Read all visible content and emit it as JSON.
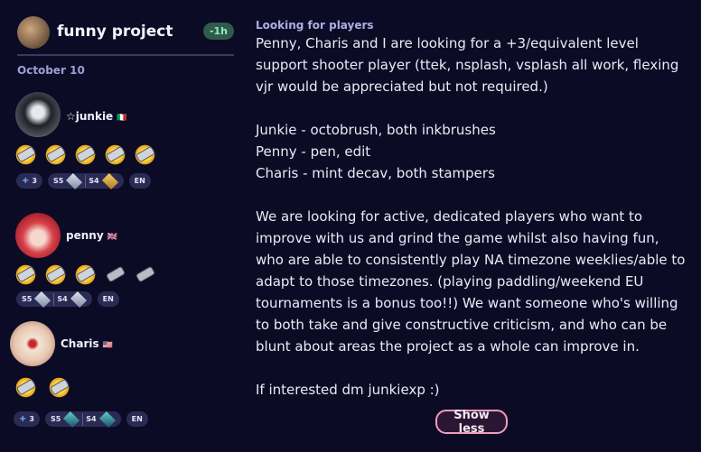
{
  "team": {
    "name": "funny project",
    "time_ago": "-1h"
  },
  "date": "October 10",
  "players": [
    {
      "name": "☆junkie",
      "flag": "🇮🇹",
      "weapons": [
        "weapon-icon",
        "weapon-icon",
        "weapon-icon",
        "weapon-icon",
        "weapon-icon"
      ],
      "plus_level": "3",
      "s5": "S5",
      "s4": "S4",
      "lang": "EN"
    },
    {
      "name": "penny",
      "flag": "🇬🇧",
      "weapons": [
        "weapon-icon",
        "weapon-icon",
        "weapon-icon",
        "weapon-icon",
        "weapon-icon"
      ],
      "s5": "S5",
      "s4": "S4",
      "lang": "EN"
    },
    {
      "name": "Charis",
      "flag": "🇺🇸",
      "weapons": [
        "weapon-icon",
        "weapon-icon"
      ],
      "plus_level": "3",
      "s5": "S5",
      "s4": "S4",
      "lang": "EN"
    }
  ],
  "post": {
    "title": "Looking for players",
    "body": "Penny, Charis and I are looking for a +3/equivalent level support shooter player (ttek, nsplash, vsplash all work, flexing vjr would be appreciated but not required.)\n\nJunkie - octobrush, both inkbrushes\nPenny - pen, edit\nCharis - mint decav, both stampers\n\nWe are looking for active, dedicated players who want to improve with us and grind the game whilst also having fun, who are able to consistently play NA timezone weeklies/able to adapt to those timezones. (playing paddling/weekend EU tournaments is a bonus too!!) We want someone who's willing to both take and give constructive criticism, and who can be blunt about areas the project as a whole can improve in.\n\nIf interested dm junkiexp :)",
    "show_less_label": "Show less"
  }
}
